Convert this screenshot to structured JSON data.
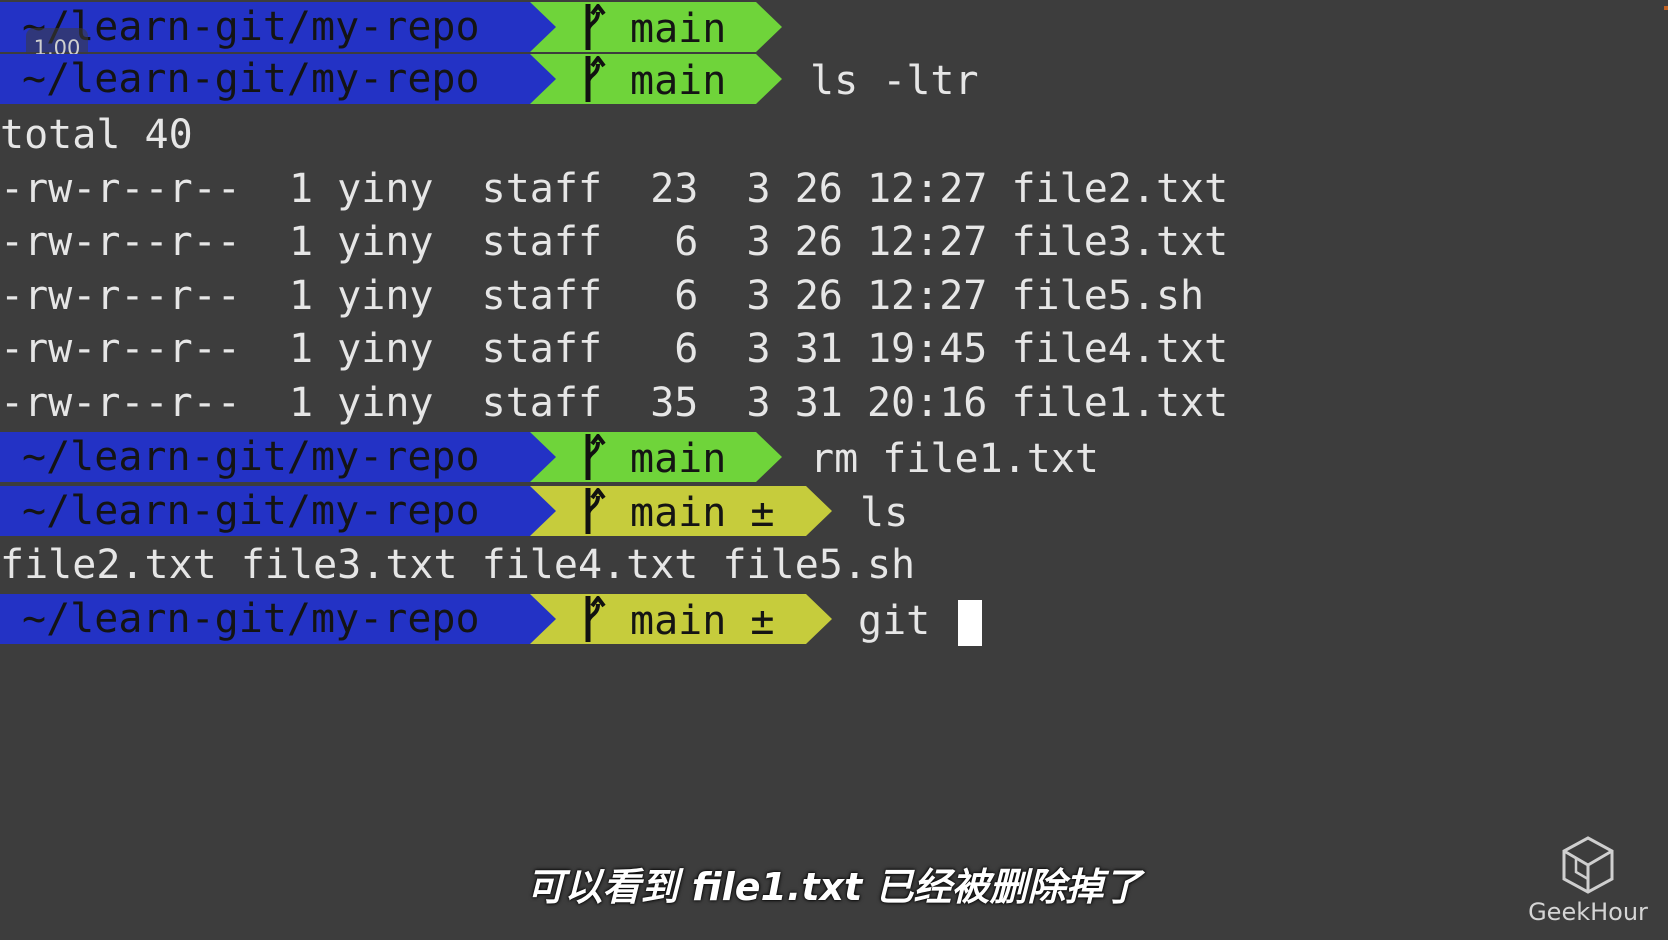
{
  "speed_badge": "1.00",
  "prompt": {
    "path": "~/learn-git/my-repo",
    "branch_clean": "main",
    "branch_dirty": "main ±"
  },
  "lines": {
    "l1": {
      "cmd": ""
    },
    "l2": {
      "cmd": "ls -ltr"
    },
    "ls_total": "total 40",
    "ls_rows": [
      "-rw-r--r--  1 yiny  staff  23  3 26 12:27 file2.txt",
      "-rw-r--r--  1 yiny  staff   6  3 26 12:27 file3.txt",
      "-rw-r--r--  1 yiny  staff   6  3 26 12:27 file5.sh",
      "-rw-r--r--  1 yiny  staff   6  3 31 19:45 file4.txt",
      "-rw-r--r--  1 yiny  staff  35  3 31 20:16 file1.txt"
    ],
    "l3": {
      "cmd": "rm file1.txt"
    },
    "l4": {
      "cmd": "ls"
    },
    "ls_output": "file2.txt file3.txt file4.txt file5.sh",
    "l5": {
      "cmd": "git "
    }
  },
  "subtitle": "可以看到 file1.txt 已经被删除掉了",
  "watermark": "GeekHour",
  "colors": {
    "background": "#3d3d3d",
    "path_segment": "#2332c5",
    "git_clean": "#6fd43a",
    "git_dirty": "#c6cc3c"
  },
  "icons": {
    "branch": "git-branch-icon",
    "watermark": "cube-logo-icon"
  }
}
